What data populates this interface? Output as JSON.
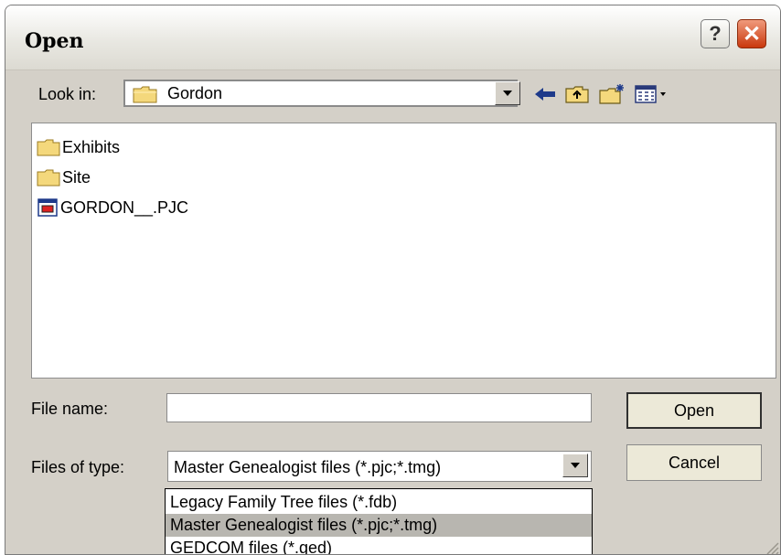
{
  "window": {
    "title": "Open",
    "help_glyph": "?",
    "close_glyph": "✕"
  },
  "look_in": {
    "label": "Look in:",
    "value": "Gordon"
  },
  "toolbar": {
    "back_icon": "back-arrow-icon",
    "up_icon": "up-folder-icon",
    "new_folder_icon": "new-folder-icon",
    "view_menu_icon": "view-menu-icon"
  },
  "files": [
    {
      "name": "Exhibits",
      "type": "folder"
    },
    {
      "name": "Site",
      "type": "folder"
    },
    {
      "name": "GORDON__.PJC",
      "type": "file"
    }
  ],
  "file_name": {
    "label": "File name:",
    "value": ""
  },
  "files_of_type": {
    "label": "Files of type:",
    "value": "Master Genealogist files (*.pjc;*.tmg)",
    "options": [
      "Legacy Family Tree files (*.fdb)",
      "Master Genealogist files (*.pjc;*.tmg)",
      "GEDCOM files (*.ged)"
    ],
    "selected_index": 1
  },
  "buttons": {
    "open": "Open",
    "cancel": "Cancel"
  },
  "colors": {
    "selection": "#b8b6b0",
    "close_button": "#c9380d",
    "dialog_face": "#d4d0c8"
  }
}
